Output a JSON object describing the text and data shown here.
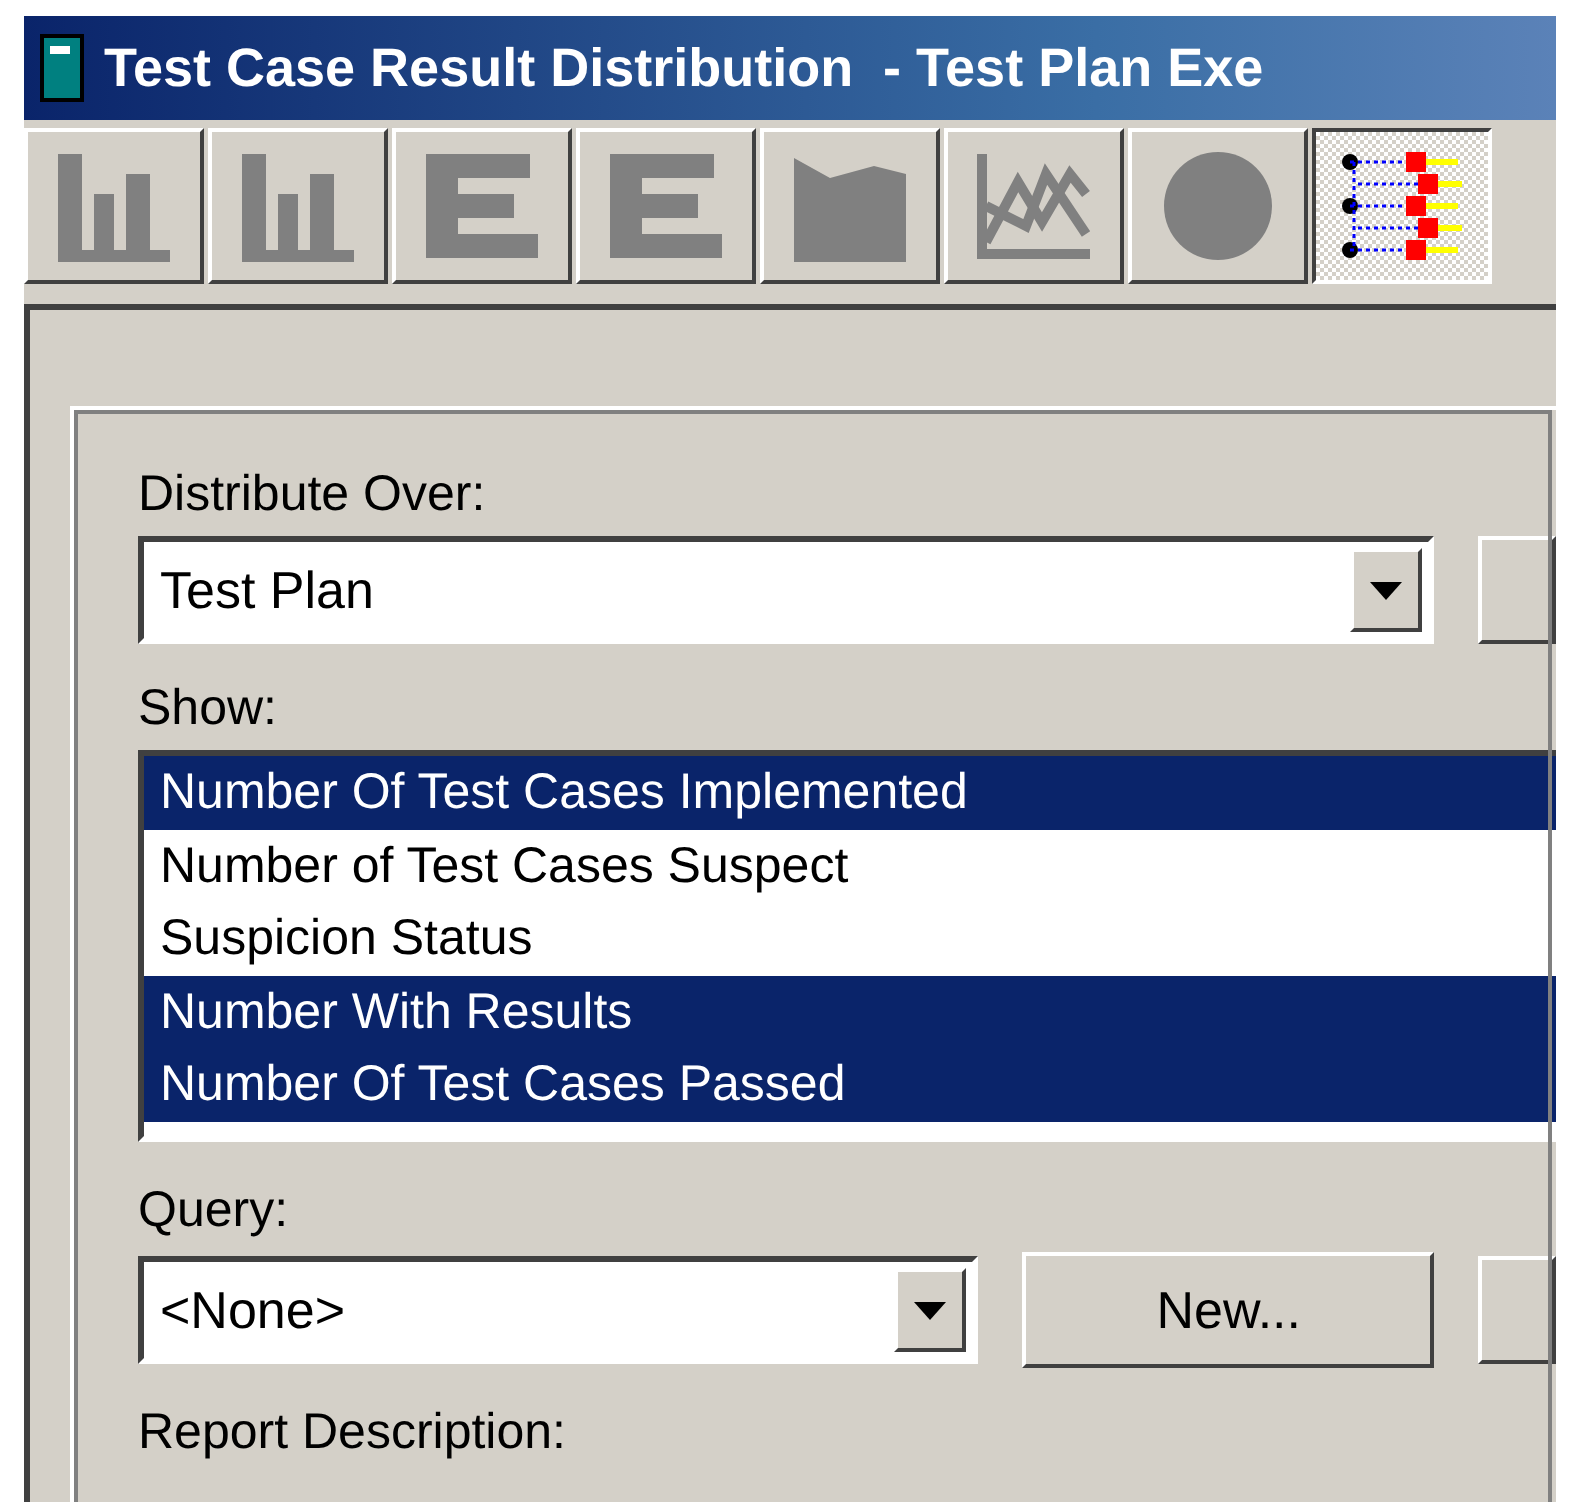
{
  "window": {
    "title": "Test Case Result Distribution  - Test Plan Exe"
  },
  "toolbar": [
    {
      "kind": "bars",
      "selected": false
    },
    {
      "kind": "bars",
      "selected": false
    },
    {
      "kind": "hbars",
      "selected": false
    },
    {
      "kind": "hbars",
      "selected": false
    },
    {
      "kind": "area",
      "selected": false
    },
    {
      "kind": "scatter",
      "selected": false
    },
    {
      "kind": "pie",
      "selected": false
    },
    {
      "kind": "tree",
      "selected": true
    }
  ],
  "distribute_over": {
    "label": "Distribute Over:",
    "value": "Test Plan"
  },
  "show": {
    "label": "Show:",
    "items": [
      {
        "label": "Number Of Test Cases Implemented",
        "selected": true
      },
      {
        "label": "Number of Test Cases Suspect",
        "selected": false
      },
      {
        "label": "Suspicion Status",
        "selected": false
      },
      {
        "label": "Number With Results",
        "selected": true
      },
      {
        "label": "Number Of Test Cases Passed",
        "selected": true
      }
    ]
  },
  "query": {
    "label": "Query:",
    "value": "<None>",
    "button": "New..."
  },
  "report_description": {
    "label": "Report Description:"
  }
}
